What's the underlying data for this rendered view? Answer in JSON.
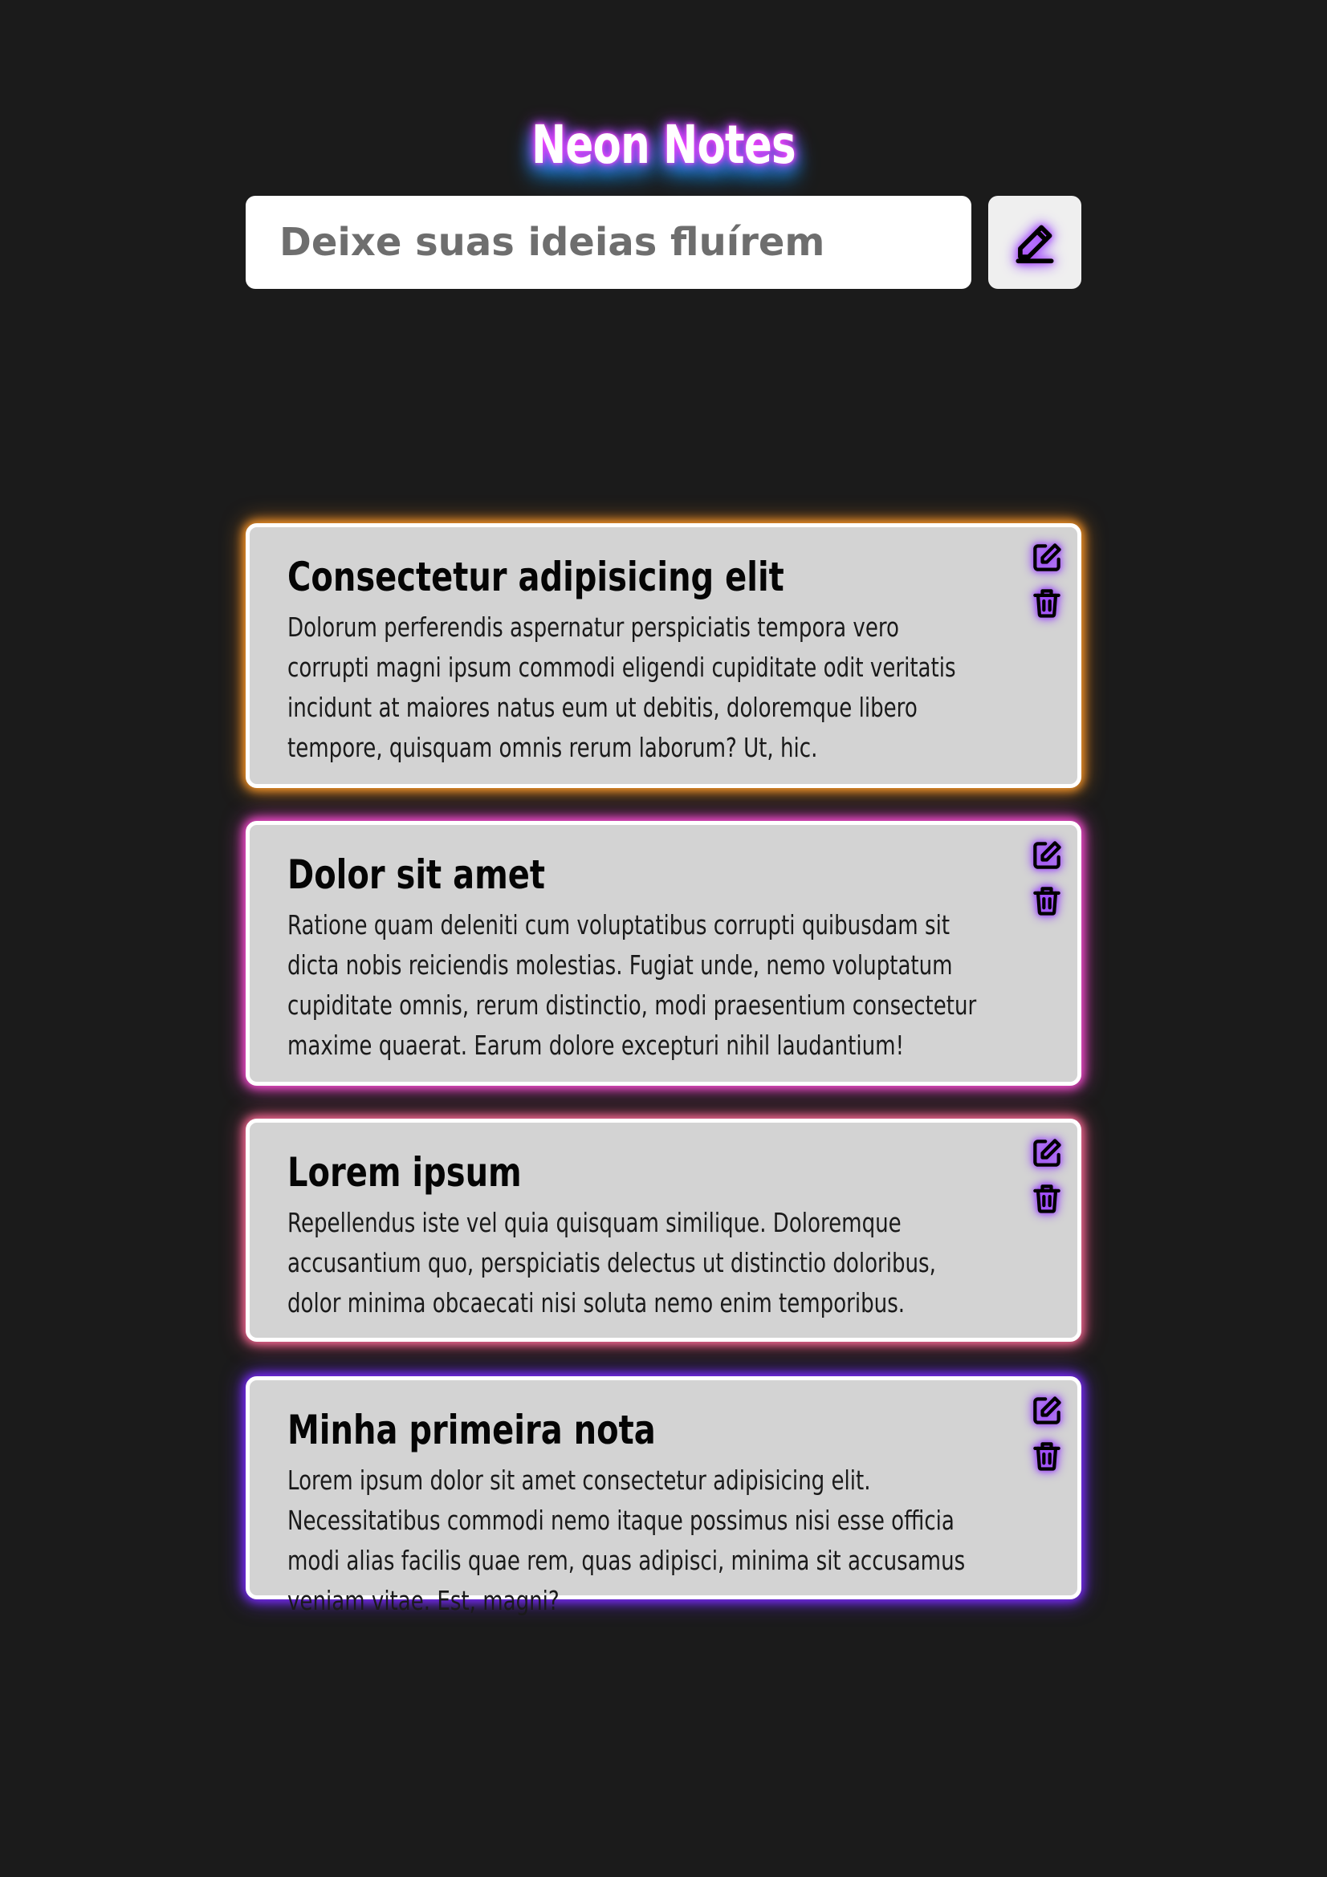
{
  "app": {
    "title": "Neon Notes"
  },
  "composer": {
    "placeholder": "Deixe suas ideias fluírem",
    "value": "",
    "add_icon": "pencil-icon"
  },
  "notes": [
    {
      "title": "Consectetur adipisicing elit",
      "body": "Dolorum perferendis aspernatur perspiciatis tempora vero corrupti magni ipsum commodi eligendi cupiditate odit veritatis incidunt at maiores natus eum ut debitis, doloremque libero tempore, quisquam omnis rerum laborum? Ut, hic.",
      "glow_color": "#ff9b2a",
      "edit_icon": "edit-icon",
      "delete_icon": "trash-icon"
    },
    {
      "title": "Dolor sit amet",
      "body": "Ratione quam deleniti cum voluptatibus corrupti quibusdam sit dicta nobis reiciendis molestias. Fugiat unde, nemo voluptatum cupiditate omnis, rerum distinctio, modi praesentium consectetur maxime quaerat. Earum dolore excepturi nihil laudantium!",
      "glow_color": "#ff4fd8",
      "edit_icon": "edit-icon",
      "delete_icon": "trash-icon"
    },
    {
      "title": "Lorem ipsum",
      "body": "Repellendus iste vel quia quisquam similique. Doloremque accusantium quo, perspiciatis delectus ut distinctio doloribus, dolor minima obcaecati nisi soluta nemo enim temporibus.",
      "glow_color": "#ff6f9a",
      "edit_icon": "edit-icon",
      "delete_icon": "trash-icon"
    },
    {
      "title": "Minha primeira nota",
      "body": "Lorem ipsum dolor sit amet consectetur adipisicing elit. Necessitatibus commodi nemo itaque possimus nisi esse officia modi alias facilis quae rem, quas adipisci, minima sit accusamus veniam vitae. Est, magni?",
      "glow_color": "#7d2bff",
      "edit_icon": "edit-icon",
      "delete_icon": "trash-icon"
    }
  ],
  "colors": {
    "background": "#1b1b1b",
    "card": "#d3d3d3",
    "icon_glow": "#8c2bff"
  }
}
